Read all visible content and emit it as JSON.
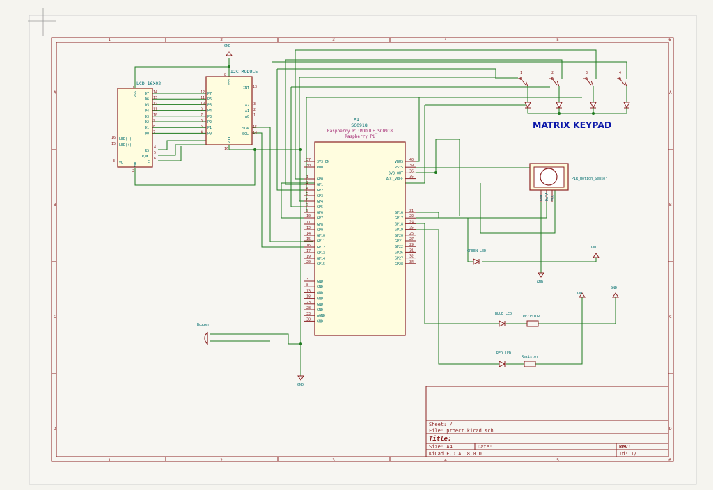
{
  "sheet": {
    "col_markers": [
      "1",
      "2",
      "3",
      "4",
      "5",
      "6"
    ],
    "row_markers": [
      "A",
      "B",
      "C",
      "D"
    ]
  },
  "power": {
    "gnd": "GND"
  },
  "lcd": {
    "ref": "LCD 16X02",
    "vss": "VSS",
    "vdd": "VDD",
    "vo": "VO",
    "led_minus": "LED(-)",
    "led_plus": "LED(+)",
    "rs": "RS",
    "rw": "R/W",
    "e": "E",
    "data_pins": [
      {
        "label": "D7",
        "num": "14"
      },
      {
        "label": "D6",
        "num": "13"
      },
      {
        "label": "D5",
        "num": "12"
      },
      {
        "label": "D4",
        "num": "11"
      },
      {
        "label": "D3",
        "num": "10"
      },
      {
        "label": "D2",
        "num": "9"
      },
      {
        "label": "D1",
        "num": "8"
      },
      {
        "label": "D0",
        "num": "7"
      }
    ],
    "left_nums": {
      "led_minus": "16",
      "led_plus": "15",
      "vo": "3"
    },
    "ctrl_nums": {
      "rs": "4",
      "rw": "5",
      "e": "6"
    },
    "vss_num": "1",
    "vdd_num": "2"
  },
  "i2c": {
    "ref": "I2C MODULE",
    "vss": "VSS",
    "vdd": "VDD",
    "int": "INT",
    "a2": "A2",
    "a1": "A1",
    "a0": "A0",
    "sda": "SDA",
    "scl": "SCL",
    "p_pins": [
      {
        "label": "P7",
        "num": "12"
      },
      {
        "label": "P6",
        "num": "11"
      },
      {
        "label": "P5",
        "num": "10"
      },
      {
        "label": "P4",
        "num": "9"
      },
      {
        "label": "P3",
        "num": "7"
      },
      {
        "label": "P2",
        "num": "6"
      },
      {
        "label": "P1",
        "num": "5"
      },
      {
        "label": "P0",
        "num": "4"
      }
    ],
    "nums": {
      "int": "13",
      "a2": "3",
      "a1": "2",
      "a0": "1",
      "sda": "15",
      "scl": "14",
      "vdd": "16",
      "vss": "8"
    }
  },
  "pico": {
    "ref": "A1",
    "value": "SC0918",
    "footprint": "Raspberry Pi:MODULE_SC0918",
    "lib": "Raspberry Pi",
    "left_pins": [
      {
        "label": "3V3_EN",
        "num": "37"
      },
      {
        "label": "RUN",
        "num": "30"
      },
      {
        "label": "GP0",
        "num": "1"
      },
      {
        "label": "GP1",
        "num": "2"
      },
      {
        "label": "GP2",
        "num": "4"
      },
      {
        "label": "GP3",
        "num": "5"
      },
      {
        "label": "GP4",
        "num": "6"
      },
      {
        "label": "GP5",
        "num": "7"
      },
      {
        "label": "GP6",
        "num": "9"
      },
      {
        "label": "GP7",
        "num": "10"
      },
      {
        "label": "GP8",
        "num": "11"
      },
      {
        "label": "GP9",
        "num": "12"
      },
      {
        "label": "GP10",
        "num": "14"
      },
      {
        "label": "GP11",
        "num": "15"
      },
      {
        "label": "GP12",
        "num": "16"
      },
      {
        "label": "GP13",
        "num": "17"
      },
      {
        "label": "GP14",
        "num": "19"
      },
      {
        "label": "GP15",
        "num": "20"
      }
    ],
    "gnd_pins": [
      {
        "label": "GND",
        "num": "3"
      },
      {
        "label": "GND",
        "num": "8"
      },
      {
        "label": "GND",
        "num": "13"
      },
      {
        "label": "GND",
        "num": "18"
      },
      {
        "label": "GND",
        "num": "23"
      },
      {
        "label": "GND",
        "num": "28"
      },
      {
        "label": "AGND",
        "num": "33"
      },
      {
        "label": "GND",
        "num": "38"
      }
    ],
    "right_top": [
      {
        "label": "VBUS",
        "num": "40"
      },
      {
        "label": "VSYS",
        "num": "39"
      },
      {
        "label": "3V3_OUT",
        "num": "36"
      },
      {
        "label": "ADC_VREF",
        "num": "35"
      }
    ],
    "right_gp": [
      {
        "label": "GP16",
        "num": "21"
      },
      {
        "label": "GP17",
        "num": "22"
      },
      {
        "label": "GP18",
        "num": "24"
      },
      {
        "label": "GP19",
        "num": "25"
      },
      {
        "label": "GP20",
        "num": "26"
      },
      {
        "label": "GP21",
        "num": "27"
      },
      {
        "label": "GP22",
        "num": "29"
      },
      {
        "label": "GP26",
        "num": "31"
      },
      {
        "label": "GP27",
        "num": "32"
      },
      {
        "label": "GP28",
        "num": "34"
      }
    ]
  },
  "keypad": {
    "title": "MATRIX KEYPAD",
    "keys": [
      "1",
      "2",
      "3",
      "4"
    ]
  },
  "pir": {
    "ref": "PIR_Motion_Sensor",
    "pins": [
      "GND",
      "DATA",
      "VCC"
    ]
  },
  "leds": {
    "green": "GREEN LED",
    "blue": "BLUE LED",
    "red": "RED LED",
    "res_blue": "REZISTOR",
    "res_red": "Rezistor"
  },
  "buzzer": {
    "ref": "Buzzer"
  },
  "title_block": {
    "sheet": "Sheet: /",
    "file": "File: proect.kicad_sch",
    "title": "Title:",
    "size": "Size: A4",
    "date": "Date:",
    "rev": "Rev:",
    "kicad": "KiCad E.D.A. 8.0.0",
    "id": "Id: 1/1"
  },
  "colors": {
    "frame": "#8b2222",
    "wire": "#1e7a1e",
    "keypad_title": "#0a16a8",
    "pin_label": "#006d6d",
    "pico_text": "#a0206c"
  }
}
